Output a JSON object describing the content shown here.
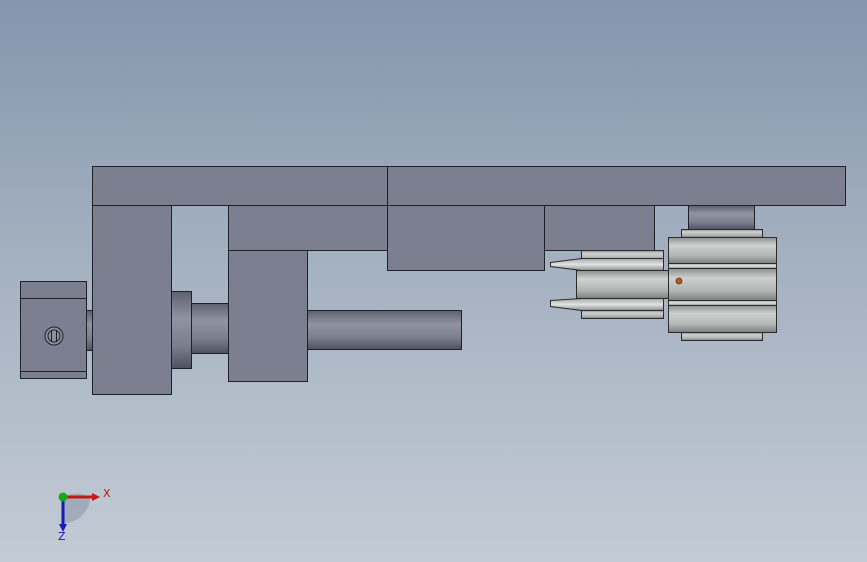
{
  "viewport": {
    "background_top": "#8496ac",
    "background_bottom": "#c3cbd5"
  },
  "model": {
    "part_color": "#7b7f8f",
    "part_edge_color": "#1f2128",
    "roller_color": "#b8b9b9",
    "marker_color": "#b65c1c"
  },
  "triad": {
    "x_label": "X",
    "z_label": "Z",
    "x_color": "#c21818",
    "y_color": "#18a818",
    "z_color": "#1a1ab8"
  }
}
